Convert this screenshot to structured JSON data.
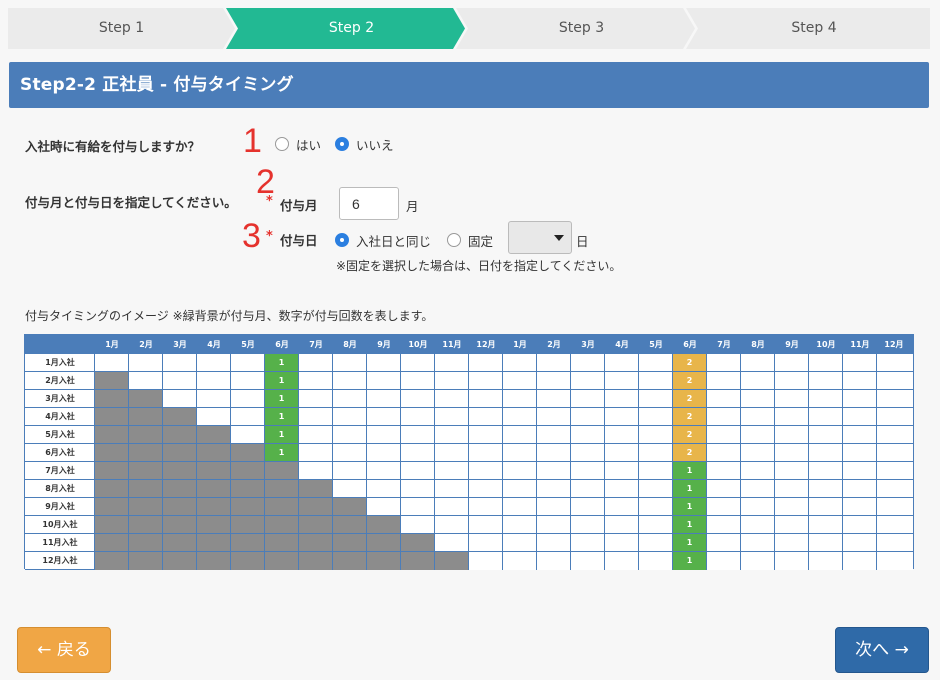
{
  "steps": [
    {
      "label": "Step 1",
      "active": false
    },
    {
      "label": "Step 2",
      "active": true
    },
    {
      "label": "Step 3",
      "active": false
    },
    {
      "label": "Step 4",
      "active": false
    }
  ],
  "colors": {
    "step_active": "#22b993",
    "step_inactive": "#ebebeb",
    "header": "#4b7db9",
    "green_cell": "#56b14a",
    "gold_cell": "#e8b54a",
    "gray_cell": "#8c8c8c",
    "back_button": "#f0a645",
    "next_button": "#2f6aa8",
    "annotation_red": "#e5322d"
  },
  "header": {
    "title": "Step2-2 正社員 - 付与タイミング"
  },
  "q1": {
    "label": "入社時に有給を付与しますか？",
    "annotation": "1",
    "options": [
      {
        "label": "はい",
        "checked": false
      },
      {
        "label": "いいえ",
        "checked": true
      }
    ]
  },
  "q2": {
    "label": "付与月と付与日を指定してください。",
    "annotation_month": "2",
    "annotation_day": "3",
    "required_mark": "*",
    "month_label": "付与月",
    "month_value": "6",
    "month_unit": "月",
    "day_label": "付与日",
    "day_options": [
      {
        "label": "入社日と同じ",
        "checked": true
      },
      {
        "label": "固定",
        "checked": false
      }
    ],
    "day_select_value": "",
    "day_unit": "日",
    "note": "※固定を選択した場合は、日付を指定してください。"
  },
  "timeline": {
    "caption": "付与タイミングのイメージ ※緑背景が付与月、数字が付与回数を表します。",
    "columns": [
      "1月",
      "2月",
      "3月",
      "4月",
      "5月",
      "6月",
      "7月",
      "8月",
      "9月",
      "10月",
      "11月",
      "12月",
      "1月",
      "2月",
      "3月",
      "4月",
      "5月",
      "6月",
      "7月",
      "8月",
      "9月",
      "10月",
      "11月",
      "12月"
    ],
    "rows": [
      {
        "label": "1月入社",
        "gray_count": 0,
        "first_grant": "1",
        "second_grant": "2"
      },
      {
        "label": "2月入社",
        "gray_count": 1,
        "first_grant": "1",
        "second_grant": "2"
      },
      {
        "label": "3月入社",
        "gray_count": 2,
        "first_grant": "1",
        "second_grant": "2"
      },
      {
        "label": "4月入社",
        "gray_count": 3,
        "first_grant": "1",
        "second_grant": "2"
      },
      {
        "label": "5月入社",
        "gray_count": 4,
        "first_grant": "1",
        "second_grant": "2"
      },
      {
        "label": "6月入社",
        "gray_count": 5,
        "first_grant": "1",
        "second_grant": "2"
      },
      {
        "label": "7月入社",
        "gray_count": 6,
        "first_grant": "",
        "second_grant": "1"
      },
      {
        "label": "8月入社",
        "gray_count": 7,
        "first_grant": "",
        "second_grant": "1"
      },
      {
        "label": "9月入社",
        "gray_count": 8,
        "first_grant": "",
        "second_grant": "1"
      },
      {
        "label": "10月入社",
        "gray_count": 9,
        "first_grant": "",
        "second_grant": "1"
      },
      {
        "label": "11月入社",
        "gray_count": 10,
        "first_grant": "",
        "second_grant": "1"
      },
      {
        "label": "12月入社",
        "gray_count": 11,
        "first_grant": "",
        "second_grant": "1"
      }
    ],
    "grant_month_index_first": 5,
    "grant_month_index_second": 17
  },
  "buttons": {
    "back": "← 戻る",
    "next": "次へ →"
  }
}
